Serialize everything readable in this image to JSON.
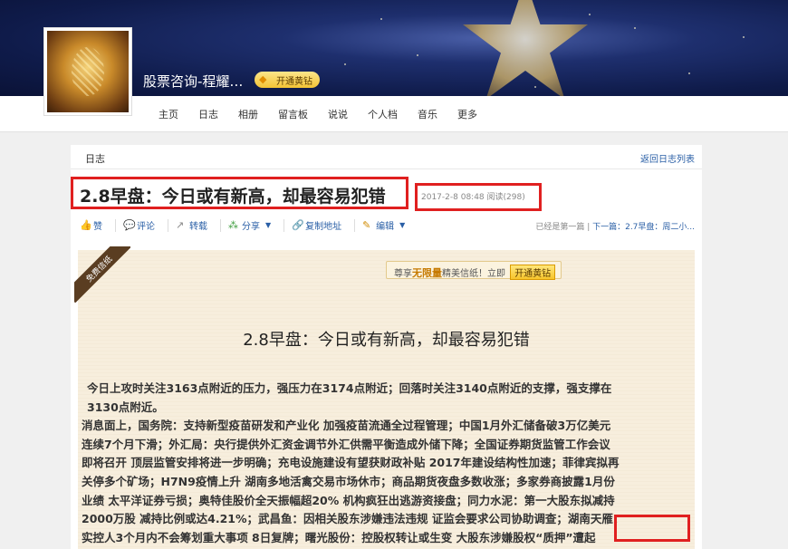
{
  "header": {
    "blog_title": "股票咨询-程耀…",
    "vip_label": "开通黄钻"
  },
  "nav": {
    "items": [
      "主页",
      "日志",
      "相册",
      "留言板",
      "说说",
      "个人档",
      "音乐",
      "更多"
    ]
  },
  "panel": {
    "breadcrumb": "日志",
    "back_link": "返回日志列表",
    "post_title": "2.8早盘：今日或有新高，却最容易犯错",
    "post_meta": "2017-2-8 08:48   阅读(298)",
    "toolbar": {
      "like": "赞",
      "comment": "评论",
      "repost": "转载",
      "share": "分享",
      "copy_link": "复制地址",
      "edit": "编辑"
    },
    "post_nav": {
      "first_note": "已经是第一篇",
      "separator": " | ",
      "next": "下一篇：2.7早盘：周二小..."
    }
  },
  "letter": {
    "ribbon": "免费信纸",
    "promo_prefix": "尊享",
    "promo_highlight": "无限量",
    "promo_suffix": "精美信纸！立即",
    "promo_button": "开通黄钻",
    "title": "2.8早盘：今日或有新高，却最容易犯错",
    "lines": [
      "今日上攻时关注3163点附近的压力，强压力在3174点附近；回落时关注3140点附近的支撑，强支撑在",
      "3130点附近。",
      "消息面上，国务院：支持新型疫苗研发和产业化 加强疫苗流通全过程管理；中国1月外汇储备破3万亿美元",
      "连续7个月下滑；外汇局：央行提供外汇资金调节外汇供需平衡造成外储下降；全国证券期货监管工作会议",
      "即将召开 顶层监管安排将进一步明确；充电设施建设有望获财政补贴 2017年建设结构性加速；菲律宾拟再",
      "关停多个矿场；H7N9疫情上升 湖南多地活禽交易市场休市；商品期货夜盘多数收涨；多家券商披露1月份",
      "业绩 太平洋证券亏损；奥特佳股价全天振幅超20% 机构疯狂出逃游资接盘；同力水泥：第一大股东拟减持",
      "2000万股 减持比例或达4.21%；武昌鱼：因相关股东涉嫌违法违规 证监会要求公司协助调查；湖南天雁：",
      "实控人3个月内不会筹划重大事项 8日复牌；曙光股份：控股权转让或生变 大股东涉嫌股权“质押”遭起"
    ]
  },
  "colors": {
    "highlight_box": "#e02020",
    "link": "#2a5fa6",
    "letter_bg": "#f7eedd"
  }
}
